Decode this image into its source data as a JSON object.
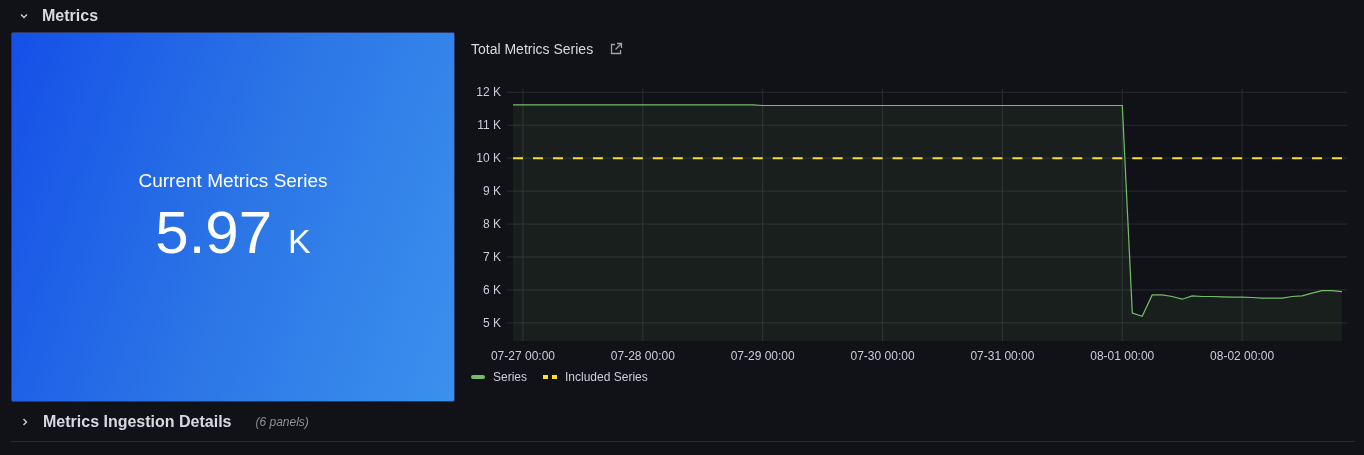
{
  "rows": [
    {
      "title": "Metrics",
      "expanded": true
    },
    {
      "title": "Metrics Ingestion Details",
      "expanded": false,
      "count": "(6 panels)"
    }
  ],
  "stat_panel": {
    "title": "Current Metrics Series",
    "value": "5.97",
    "unit": "K"
  },
  "chart_panel": {
    "title": "Total Metrics Series",
    "chart_data": {
      "type": "line",
      "grid": true,
      "ylim": [
        4.45,
        12.1
      ],
      "categories": [
        null,
        "07-27 00:00",
        null,
        null,
        null,
        null,
        null,
        null,
        null,
        null,
        null,
        null,
        null,
        "07-28 00:00",
        null,
        null,
        null,
        null,
        null,
        null,
        null,
        null,
        null,
        null,
        null,
        "07-29 00:00",
        null,
        null,
        null,
        null,
        null,
        null,
        null,
        null,
        null,
        null,
        null,
        "07-30 00:00",
        null,
        null,
        null,
        null,
        null,
        null,
        null,
        null,
        null,
        null,
        null,
        "07-31 00:00",
        null,
        null,
        null,
        null,
        null,
        null,
        null,
        null,
        null,
        null,
        null,
        "08-01 00:00",
        null,
        null,
        null,
        null,
        null,
        null,
        null,
        null,
        null,
        null,
        null,
        "08-02 00:00",
        null,
        null,
        null,
        null,
        null,
        null,
        null,
        null,
        null,
        null
      ],
      "yticks": [
        {
          "value": 5,
          "label": "5 K"
        },
        {
          "value": 6,
          "label": "6 K"
        },
        {
          "value": 7,
          "label": "7 K"
        },
        {
          "value": 8,
          "label": "8 K"
        },
        {
          "value": 9,
          "label": "9 K"
        },
        {
          "value": 10,
          "label": "10 K"
        },
        {
          "value": 11,
          "label": "11 K"
        },
        {
          "value": 12,
          "label": "12 K"
        }
      ],
      "series": [
        {
          "name": "Series",
          "type": "area",
          "line_style": "solid",
          "color": "#73bf69",
          "values": [
            11.62,
            11.62,
            11.62,
            11.62,
            11.62,
            11.62,
            11.62,
            11.62,
            11.62,
            11.62,
            11.62,
            11.62,
            11.62,
            11.62,
            11.62,
            11.62,
            11.62,
            11.62,
            11.62,
            11.62,
            11.62,
            11.62,
            11.62,
            11.62,
            11.62,
            11.6,
            11.6,
            11.6,
            11.6,
            11.6,
            11.6,
            11.6,
            11.6,
            11.6,
            11.6,
            11.6,
            11.6,
            11.6,
            11.6,
            11.6,
            11.6,
            11.6,
            11.6,
            11.6,
            11.6,
            11.6,
            11.6,
            11.6,
            11.6,
            11.6,
            11.6,
            11.6,
            11.6,
            11.6,
            11.6,
            11.6,
            11.6,
            11.6,
            11.6,
            11.6,
            11.6,
            11.6,
            5.3,
            5.2,
            5.85,
            5.85,
            5.8,
            5.72,
            5.82,
            5.8,
            5.8,
            5.79,
            5.78,
            5.78,
            5.77,
            5.75,
            5.75,
            5.75,
            5.8,
            5.82,
            5.9,
            5.98,
            5.98,
            5.95
          ]
        },
        {
          "name": "Included Series",
          "type": "line",
          "line_style": "dashed",
          "color": "#fade2a",
          "values": [
            10,
            10,
            10,
            10,
            10,
            10,
            10,
            10,
            10,
            10,
            10,
            10,
            10,
            10,
            10,
            10,
            10,
            10,
            10,
            10,
            10,
            10,
            10,
            10,
            10,
            10,
            10,
            10,
            10,
            10,
            10,
            10,
            10,
            10,
            10,
            10,
            10,
            10,
            10,
            10,
            10,
            10,
            10,
            10,
            10,
            10,
            10,
            10,
            10,
            10,
            10,
            10,
            10,
            10,
            10,
            10,
            10,
            10,
            10,
            10,
            10,
            10,
            10,
            10,
            10,
            10,
            10,
            10,
            10,
            10,
            10,
            10,
            10,
            10,
            10,
            10,
            10,
            10,
            10,
            10,
            10,
            10,
            10,
            10
          ]
        }
      ]
    }
  }
}
